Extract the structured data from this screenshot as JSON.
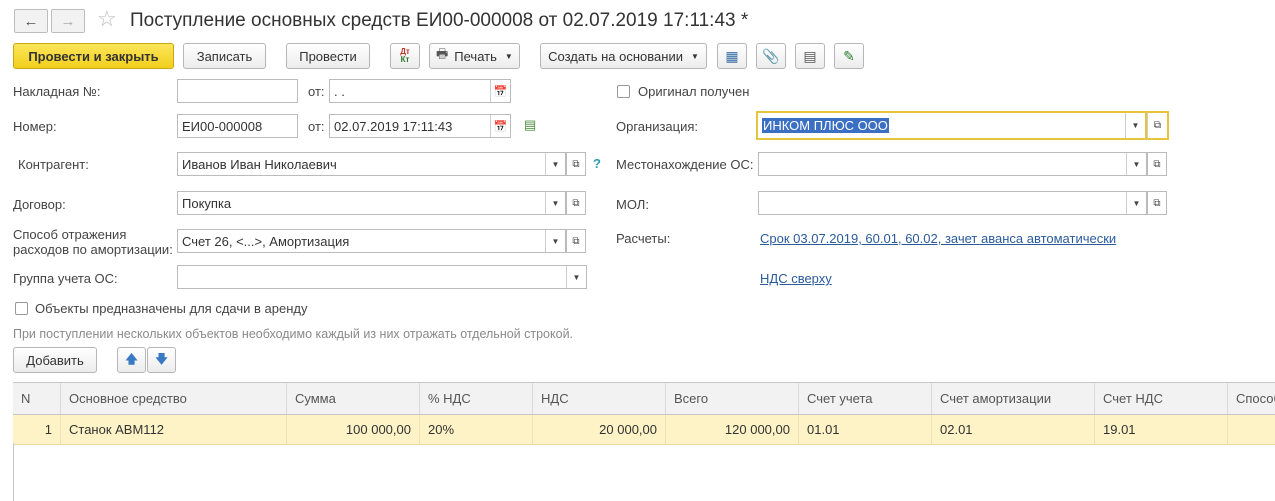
{
  "window": {
    "title": "Поступление основных средств ЕИ00-000008 от 02.07.2019 17:11:43 *"
  },
  "toolbar": {
    "post_close": "Провести и закрыть",
    "save": "Записать",
    "post": "Провести",
    "dt_kt": "Дт Кт",
    "print": "Печать",
    "create_based": "Создать на основании"
  },
  "form": {
    "invoice_label": "Накладная №:",
    "invoice_value": "",
    "from_label": "от:",
    "invoice_date": " .  .",
    "number_label": "Номер:",
    "number_value": "ЕИ00-000008",
    "number_date": "02.07.2019 17:11:43",
    "contractor_label": "Контрагент:",
    "contractor_value": "Иванов Иван Николаевич",
    "contract_label": "Договор:",
    "contract_value": "Покупка",
    "amort_label_1": "Способ отражения",
    "amort_label_2": "расходов по амортизации:",
    "amort_value": "Счет 26, <...>, Амортизация",
    "group_label": "Группа учета ОС:",
    "group_value": "",
    "rent_checkbox_label": "Объекты предназначены для сдачи в аренду",
    "original_checkbox_label": "Оригинал получен",
    "org_label": "Организация:",
    "org_value": "ИНКОМ ПЛЮС ООО",
    "location_label": "Местонахождение ОС:",
    "location_value": "",
    "mol_label": "МОЛ:",
    "mol_value": "",
    "settlements_label": "Расчеты:",
    "settlements_link": "Срок 03.07.2019, 60.01, 60.02, зачет аванса автоматически",
    "vat_link": "НДС сверху",
    "help_mark": "?",
    "hint": "При поступлении нескольких объектов необходимо каждый из них отражать отдельной строкой."
  },
  "table_toolbar": {
    "add": "Добавить"
  },
  "table": {
    "columns": [
      "N",
      "Основное средство",
      "Сумма",
      "% НДС",
      "НДС",
      "Всего",
      "Счет учета",
      "Счет амортизации",
      "Счет НДС",
      "Способ"
    ],
    "rows": [
      {
        "n": "1",
        "asset": "Станок АВМ112",
        "sum": "100 000,00",
        "vat_rate": "20%",
        "vat": "20 000,00",
        "total": "120 000,00",
        "account": "01.01",
        "amort_account": "02.01",
        "vat_account": "19.01",
        "method": ""
      }
    ]
  },
  "colors": {
    "primary_button": "#f2cf1c",
    "selected_row": "#fdf3c6",
    "link": "#2a5b9c",
    "org_field_border": "#e6c43c"
  }
}
